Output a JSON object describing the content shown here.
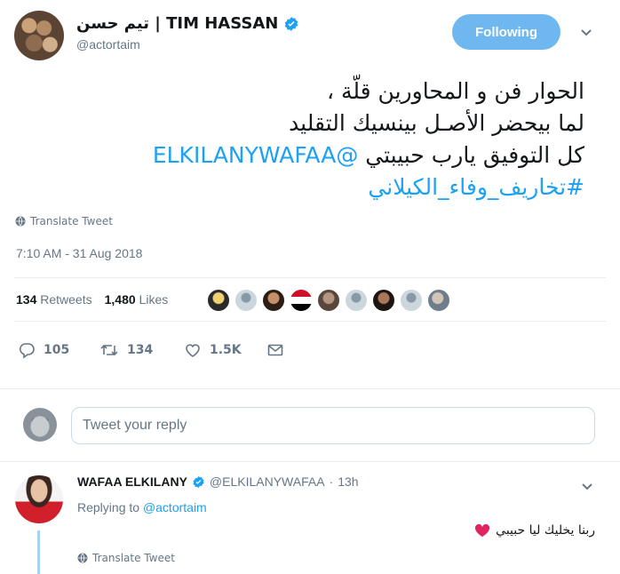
{
  "tweet": {
    "display_name": "تيم حسن | TIM HASSAN",
    "handle": "@actortaim",
    "follow_label": "Following",
    "text_lines": [
      "الحوار فن و المحاورين قلّة  ،",
      "لما بيحضر الأصـل بينسيك التقليد",
      "كل التوفيق يارب حبيبتي"
    ],
    "mention": "@ELKILANYWAFAA",
    "hashtag": "#تخاريف_وفاء_الكيلاني",
    "translate_label": "Translate Tweet",
    "timestamp": "7:10 AM - 31 Aug 2018",
    "retweets_count": "134",
    "retweets_label": "Retweets",
    "likes_count": "1,480",
    "likes_label": "Likes",
    "actions": {
      "replies": "105",
      "retweets": "134",
      "likes": "1.5K"
    }
  },
  "reply_box": {
    "placeholder": "Tweet your reply"
  },
  "reply": {
    "display_name": "WAFAA ELKILANY",
    "handle": "@ELKILANYWAFAA",
    "time": "13h",
    "replying_to_label": "Replying to",
    "replying_to_handle": "@actortaim",
    "text": "ربنا يخليك ليا حبيبي",
    "translate_label": "Translate Tweet"
  },
  "colors": {
    "accent": "#1da1f2",
    "follow_button": "#6fb7ef",
    "verified": "#1da1f2",
    "heart": "#e0245e"
  },
  "icons": {
    "verified": "verified-badge-icon",
    "chevron": "chevron-down-icon",
    "globe": "globe-icon",
    "reply": "reply-icon",
    "retweet": "retweet-icon",
    "like": "heart-icon",
    "dm": "envelope-icon"
  }
}
